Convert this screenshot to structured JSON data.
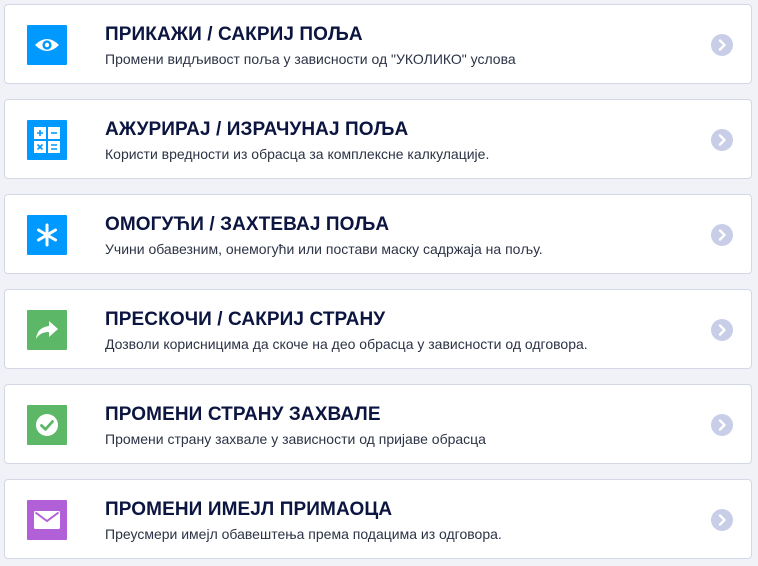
{
  "colors": {
    "blue": "#0099ff",
    "green": "#5cb866",
    "purple": "#b160d8",
    "chevron_bg": "#c8cde8",
    "title": "#0c1540"
  },
  "items": [
    {
      "title": "ПРИКАЖИ / САКРИЈ ПОЉА",
      "description": "Промени видљивост поља у зависности од \"УКОЛИКО\" услова",
      "icon": "eye-icon",
      "color": "#0099ff"
    },
    {
      "title": "АЖУРИРАЈ / ИЗРАЧУНАЈ ПОЉА",
      "description": "Користи вредности из обрасца за комплексне калкулације.",
      "icon": "calculator-icon",
      "color": "#0099ff"
    },
    {
      "title": "ОМОГУЋИ / ЗАХТЕВАЈ ПОЉА",
      "description": "Учини обавезним, онемогући или постави маску садржаја на пољу.",
      "icon": "asterisk-icon",
      "color": "#0099ff"
    },
    {
      "title": "ПРЕСКОЧИ / САКРИЈ СТРАНУ",
      "description": "Дозволи корисницима да скоче на део обрасца у зависности од одговора.",
      "icon": "share-arrow-icon",
      "color": "#5cb866"
    },
    {
      "title": "ПРОМЕНИ СТРАНУ ЗАХВАЛЕ",
      "description": "Промени страну захвале у зависности од пријаве обрасца",
      "icon": "check-circle-icon",
      "color": "#5cb866"
    },
    {
      "title": "ПРОМЕНИ ИМЕЈЛ ПРИМАОЦА",
      "description": "Преусмери имејл обавештења према подацима из одговора.",
      "icon": "envelope-icon",
      "color": "#b160d8"
    }
  ]
}
